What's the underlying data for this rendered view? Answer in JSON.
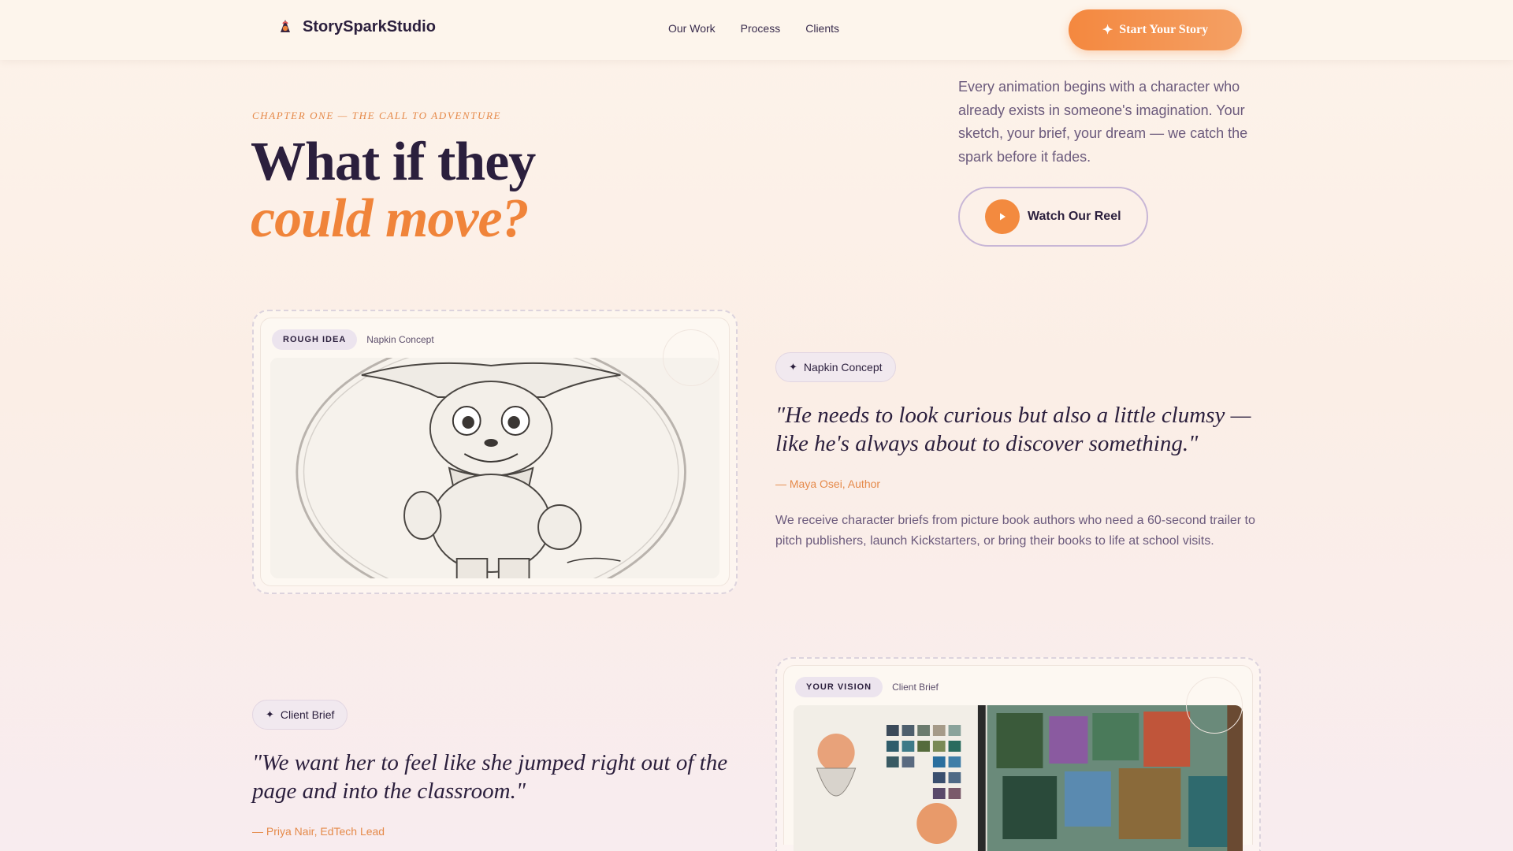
{
  "header": {
    "brand_name": "StorySparkStudio",
    "nav": [
      "Our Work",
      "Process",
      "Clients"
    ],
    "cta_label": "Start Your Story"
  },
  "hero": {
    "eyebrow": "CHAPTER ONE — THE CALL TO ADVENTURE",
    "title_line1": "What if they",
    "title_line2": "could move?",
    "copy": "Every animation begins with a character who already exists in someone's imagination. Your sketch, your brief, your dream — we catch the spark before it fades.",
    "reel_label": "Watch Our Reel"
  },
  "story1": {
    "card_tag": "ROUGH IDEA",
    "card_sub": "Napkin Concept",
    "chip": "Napkin Concept",
    "quote": "\"He needs to look curious but also a little clumsy — like he's always about to discover something.\"",
    "attribution": "— Maya Osei, Author",
    "body": "We receive character briefs from picture book authors who need a 60-second trailer to pitch publishers, launch Kickstarters, or bring their books to life at school visits."
  },
  "story2": {
    "card_tag": "YOUR VISION",
    "card_sub": "Client Brief",
    "chip": "Client Brief",
    "quote": "\"We want her to feel like she jumped right out of the page and into the classroom.\"",
    "attribution": "— Priya Nair, EdTech Lead"
  },
  "icons": {
    "brand": "paintbrush-character-icon",
    "cta": "sparkle-icon",
    "reel": "play-icon",
    "chip": "sparkle-icon"
  },
  "colors": {
    "accent": "#f0843a",
    "ink": "#2b1f3d",
    "muted": "#6b5a7c",
    "chip_bg": "#f1e9ef"
  }
}
